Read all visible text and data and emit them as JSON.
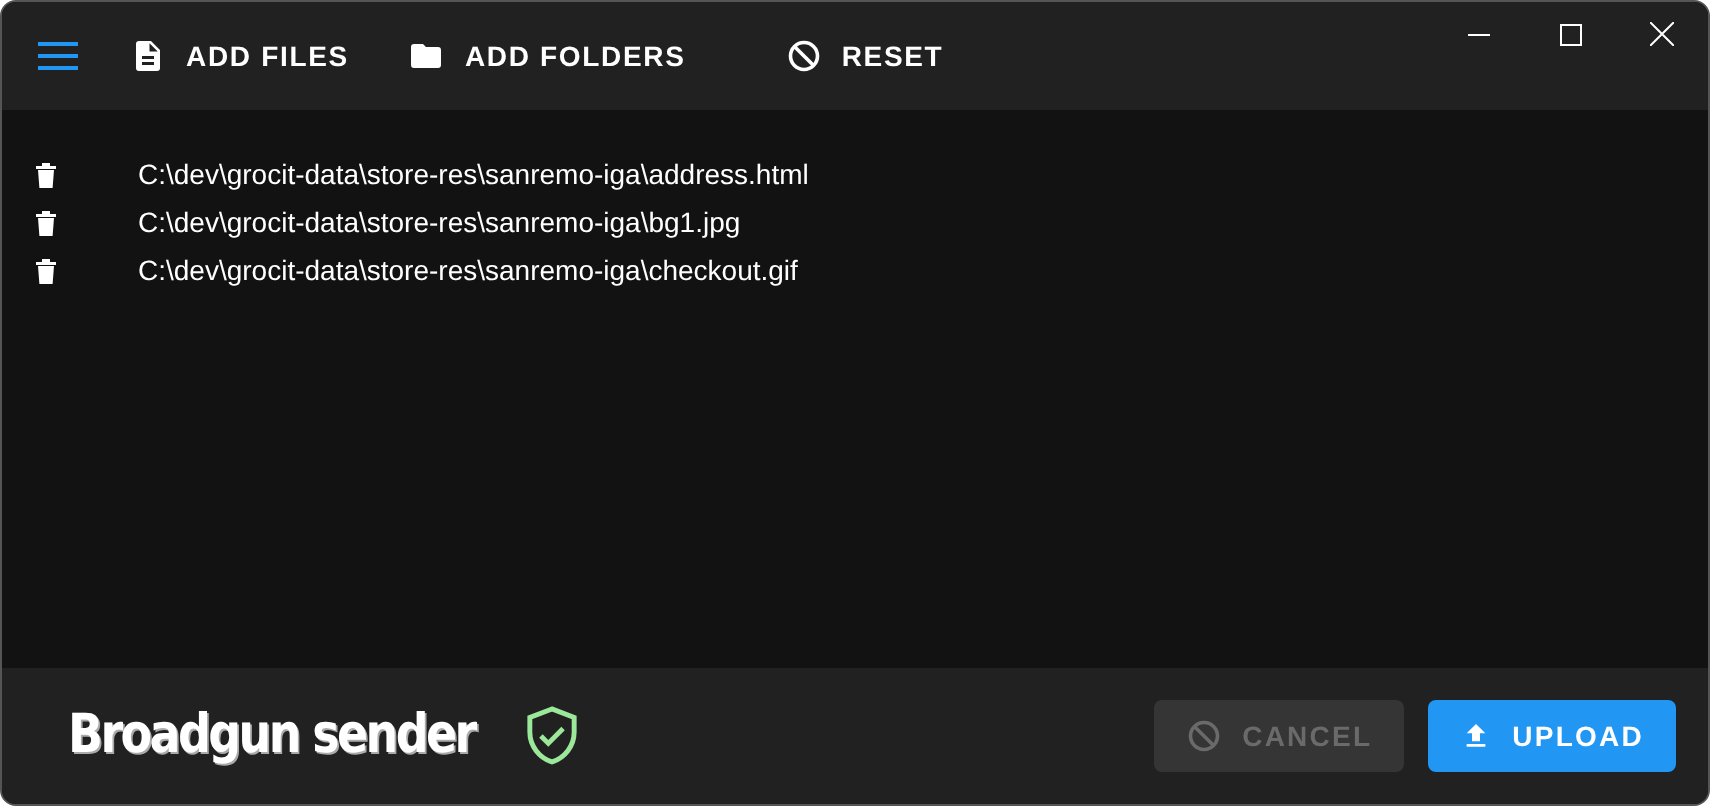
{
  "toolbar": [
    {
      "kind": "file",
      "label": "ADD FILES"
    },
    {
      "kind": "folder",
      "label": "ADD FOLDERS"
    },
    {
      "kind": "reset",
      "label": "RESET"
    }
  ],
  "files": [
    {
      "path": "C:\\dev\\grocit-data\\store-res\\sanremo-iga\\address.html"
    },
    {
      "path": "C:\\dev\\grocit-data\\store-res\\sanremo-iga\\bg1.jpg"
    },
    {
      "path": "C:\\dev\\grocit-data\\store-res\\sanremo-iga\\checkout.gif"
    }
  ],
  "footer": {
    "title": "Broadgun sender",
    "verified": true
  },
  "actions": [
    {
      "kind": "cancel",
      "label": "CANCEL",
      "disabled": true
    },
    {
      "kind": "upload",
      "label": "UPLOAD",
      "disabled": false
    }
  ]
}
